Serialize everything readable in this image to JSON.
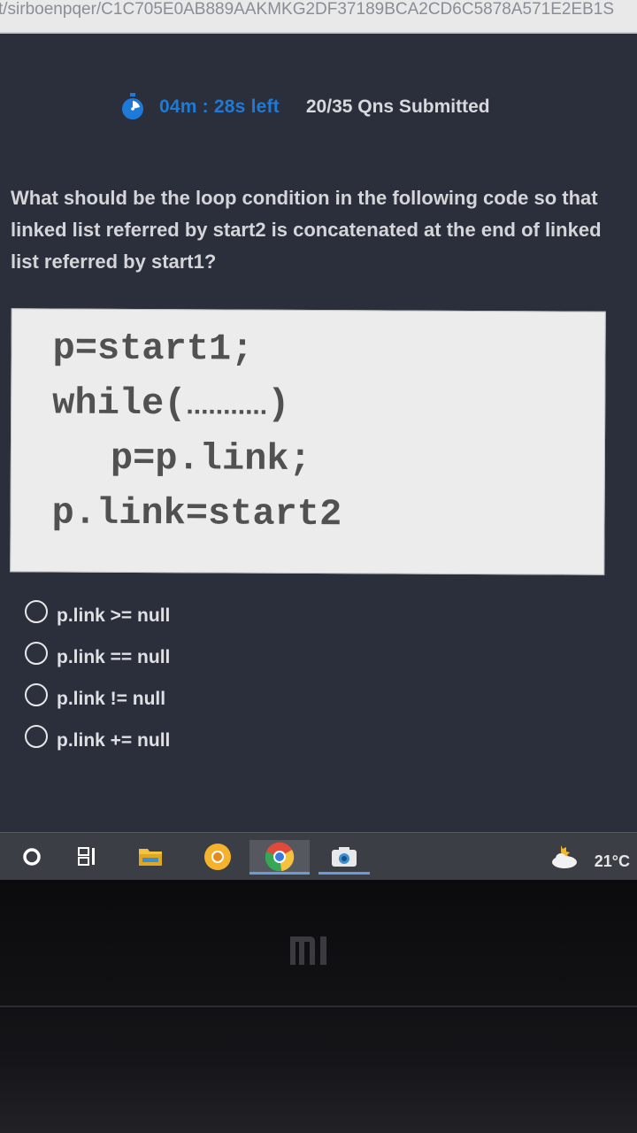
{
  "browser": {
    "url_fragment": "t/sirboenpqer/C1C705E0AB889AAKMKG2DF37189BCA2CD6C5878A571E2EB1S"
  },
  "test_header": {
    "timer_icon": "stopwatch-icon",
    "time_left": "04m : 28s  left",
    "submitted": "20/35 Qns Submitted"
  },
  "question": {
    "text": "What should be the loop condition in the following code so that linked list referred by start2 is concatenated at the end of linked list referred by start1?"
  },
  "code": {
    "line1": "p=start1;",
    "line2_prefix": "while(",
    "line2_dots": "...........",
    "line2_suffix": ")",
    "line3": "p=p.link;",
    "line4": "p.link=start2"
  },
  "options": [
    {
      "label": "p.link >= null"
    },
    {
      "label": "p.link == null"
    },
    {
      "label": "p.link != null"
    },
    {
      "label": "p.link += null"
    }
  ],
  "taskbar": {
    "items": [
      "start-circle-icon",
      "task-view-icon",
      "file-explorer-icon",
      "chrome-canary-icon",
      "chrome-icon",
      "camera-icon"
    ],
    "weather_icon": "partly-cloudy-icon",
    "temperature": "21°C"
  },
  "colors": {
    "app_bg": "#2a2f3b",
    "timer_blue": "#1e7ad8",
    "code_bg": "#ececec"
  }
}
